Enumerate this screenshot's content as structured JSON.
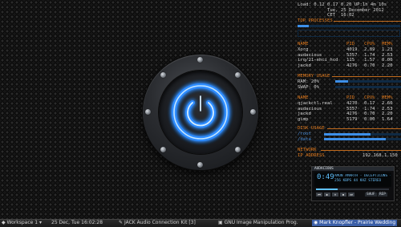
{
  "conky": {
    "load_line": "Load: 0.12 0.17 0.20 UP:1h 4m 10s",
    "date_line": "Tue, 25 December 2012",
    "time_line": "CET  16:02",
    "top_processes": {
      "heading": "TOP PROCESSES",
      "headers": {
        "name": "NAME",
        "pid": "PID",
        "cpu": "CPU%",
        "mem": "MEM%"
      },
      "rows": [
        {
          "name": "Xorg",
          "pid": "4019",
          "cpu": "2.89",
          "mem": "1.23"
        },
        {
          "name": "audacious",
          "pid": "5357",
          "cpu": "1.74",
          "mem": "2.53"
        },
        {
          "name": "irq/21-ehci_hcd",
          "pid": "115",
          "cpu": "1.57",
          "mem": "0.00"
        },
        {
          "name": "jackd",
          "pid": "4276",
          "cpu": "0.70",
          "mem": "2.20"
        }
      ]
    },
    "memory_usage": {
      "heading": "MEMORY USAGE",
      "ram_label": "RAM:",
      "ram_value": "20%",
      "ram_pct": 20,
      "swap_label": "SWAP:",
      "swap_value": "0%",
      "swap_pct": 0,
      "headers": {
        "name": "NAME",
        "pid": "PID",
        "cpu": "CPU%",
        "mem": "MEM%"
      },
      "rows": [
        {
          "name": "qjackctl.real",
          "pid": "4270",
          "cpu": "0.17",
          "mem": "2.60"
        },
        {
          "name": "audacious",
          "pid": "5357",
          "cpu": "1.74",
          "mem": "2.53"
        },
        {
          "name": "jackd",
          "pid": "4276",
          "cpu": "0.70",
          "mem": "2.20"
        },
        {
          "name": "gimp",
          "pid": "5179",
          "cpu": "0.00",
          "mem": "1.64"
        }
      ]
    },
    "disk_usage": {
      "heading": "DISK USAGE",
      "items": [
        {
          "label": "/root",
          "pct": 60
        },
        {
          "label": "/data",
          "pct": 80
        }
      ]
    },
    "network": {
      "heading": "NETWORK",
      "ip_label": "IP ADDRESS",
      "ip_value": "192.168.1.150"
    }
  },
  "audacious": {
    "title": "AUDACIOUS",
    "time": "0:49",
    "track_info": "AMON AMARTH - DECEPTICONS - 08",
    "kbps": "256 KBPS  44 KHZ  STEREO",
    "seek_pct": 30,
    "controls": [
      "⏮",
      "▶",
      "⏸",
      "⏹",
      "⏭"
    ],
    "buttons": [
      "SHUF",
      "REP"
    ]
  },
  "taskbar": {
    "workspace": "Workspace 1",
    "clock": "25 Dec, Tue 16:02:28",
    "tasks": [
      {
        "label": "JACK Audio Connection Kit [3]",
        "active": false
      },
      {
        "label": "GNU Image Manipulation Prog.",
        "active": false
      },
      {
        "label": "Mark Knopfler - Prairie Wedding",
        "active": true
      }
    ]
  },
  "colors": {
    "accent_orange": "#e07a1e",
    "accent_blue": "#3d8fe8",
    "glow_blue": "#2f8cff"
  },
  "icons": {
    "power": "power-icon",
    "bolt": "screw-bolt-icon"
  }
}
